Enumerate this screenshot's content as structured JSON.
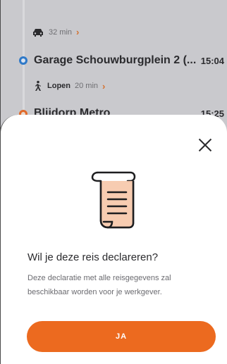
{
  "trip": {
    "leg_car": {
      "duration": "32 min"
    },
    "stop_1": {
      "name": "Garage Schouwburgplein 2 (...",
      "time": "15:04"
    },
    "leg_walk": {
      "mode": "Lopen",
      "duration": "20 min"
    },
    "stop_2": {
      "name": "Blijdorp Metro",
      "time": "15:25"
    }
  },
  "sheet": {
    "title": "Wil je deze reis declareren?",
    "description": "Deze declaratie met alle reisgegevens zal beschikbaar worden voor je werkgever.",
    "confirm_label": "JA"
  },
  "colors": {
    "accent": "#ec6a1f",
    "rail_blue": "#2f79c8",
    "rail_orange": "#e06a2a",
    "icon_fill": "#f6c7a8"
  },
  "icons": {
    "car": "car-icon",
    "walk": "walk-icon",
    "chevron": "chevron-right-icon",
    "close": "close-icon",
    "document": "document-scroll-icon"
  }
}
